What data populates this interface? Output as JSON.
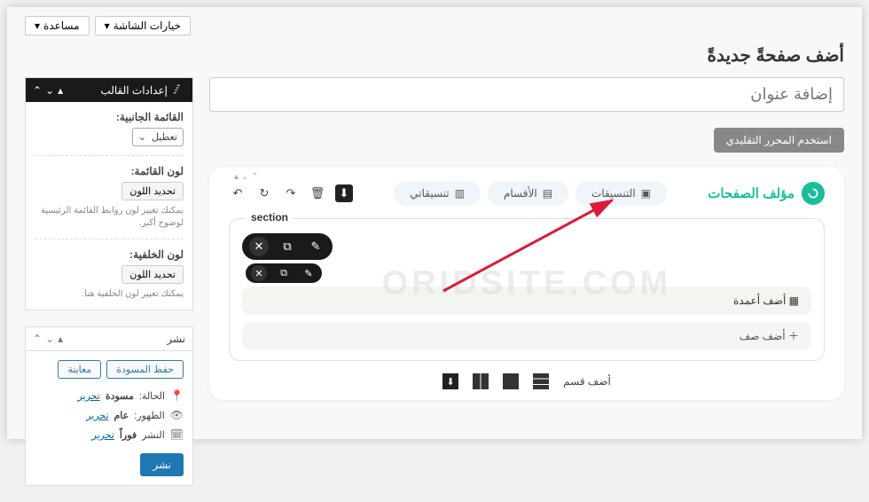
{
  "top": {
    "screen_options": "خيارات الشاشة",
    "help": "مساعدة"
  },
  "page_title": "أضف صفحةً جديدةً",
  "title_placeholder": "إضافة عنوان",
  "classic_editor_btn": "استخدم المحرر التقليدي",
  "builder": {
    "brand": "مؤلف الصفحات",
    "pill_layouts": "التنسيقات",
    "pill_sections": "الأقسام",
    "pill_mylayouts": "تنسيقاتي",
    "section_legend": "section",
    "add_columns": "أضف أعمدة",
    "add_row": "أضف صف",
    "add_section": "أضف قسم"
  },
  "watermark": "ORIDSITE.COM",
  "theme_panel": {
    "title": "إعدادات القالب",
    "sidebar_label": "القائمة الجانبية:",
    "sidebar_value": "تعطيل",
    "menu_color_label": "لون القائمة:",
    "color_btn": "تحديد اللون",
    "menu_hint": "يمكنك تغيير لون روابط القائمة الرئيسية لوضوح أكبر.",
    "bg_color_label": "لون الخلفية:",
    "bg_hint": "يمكنك تغيير لون الخلفية هنا."
  },
  "publish_panel": {
    "title": "نشر",
    "save_draft": "حفظ المسودة",
    "preview": "معاينة",
    "status_label": "الحالة:",
    "status_value": "مسودة",
    "visibility_label": "الظهور:",
    "visibility_value": "عام",
    "schedule_label": "النشر",
    "schedule_value": "فوراً",
    "edit": "تحرير",
    "publish_btn": "نشر"
  }
}
